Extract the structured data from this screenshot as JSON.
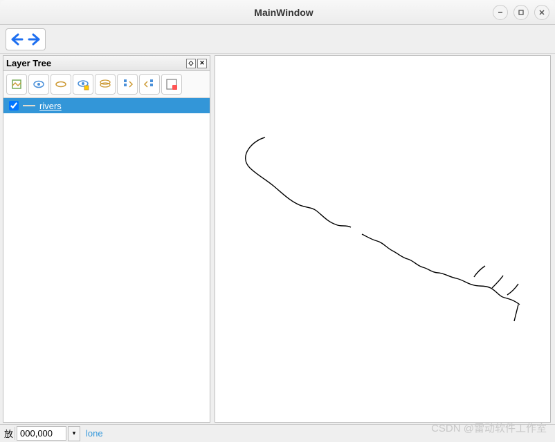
{
  "window": {
    "title": "MainWindow"
  },
  "panel": {
    "title": "Layer Tree"
  },
  "layer": {
    "name": "rivers",
    "checked": true
  },
  "toolbar": {
    "back": "back",
    "forward": "forward"
  },
  "panelTools": [
    "add-layer",
    "visibility",
    "layer",
    "filter-visibility",
    "layer-group",
    "expand",
    "collapse",
    "remove"
  ],
  "status": {
    "scalePrefix": "放",
    "scaleValue": "000,000",
    "text": "lone"
  },
  "watermark": "CSDN @雷动软件工作室",
  "colors": {
    "selection": "#3396d8",
    "navArrow": "#1e6ff0"
  }
}
